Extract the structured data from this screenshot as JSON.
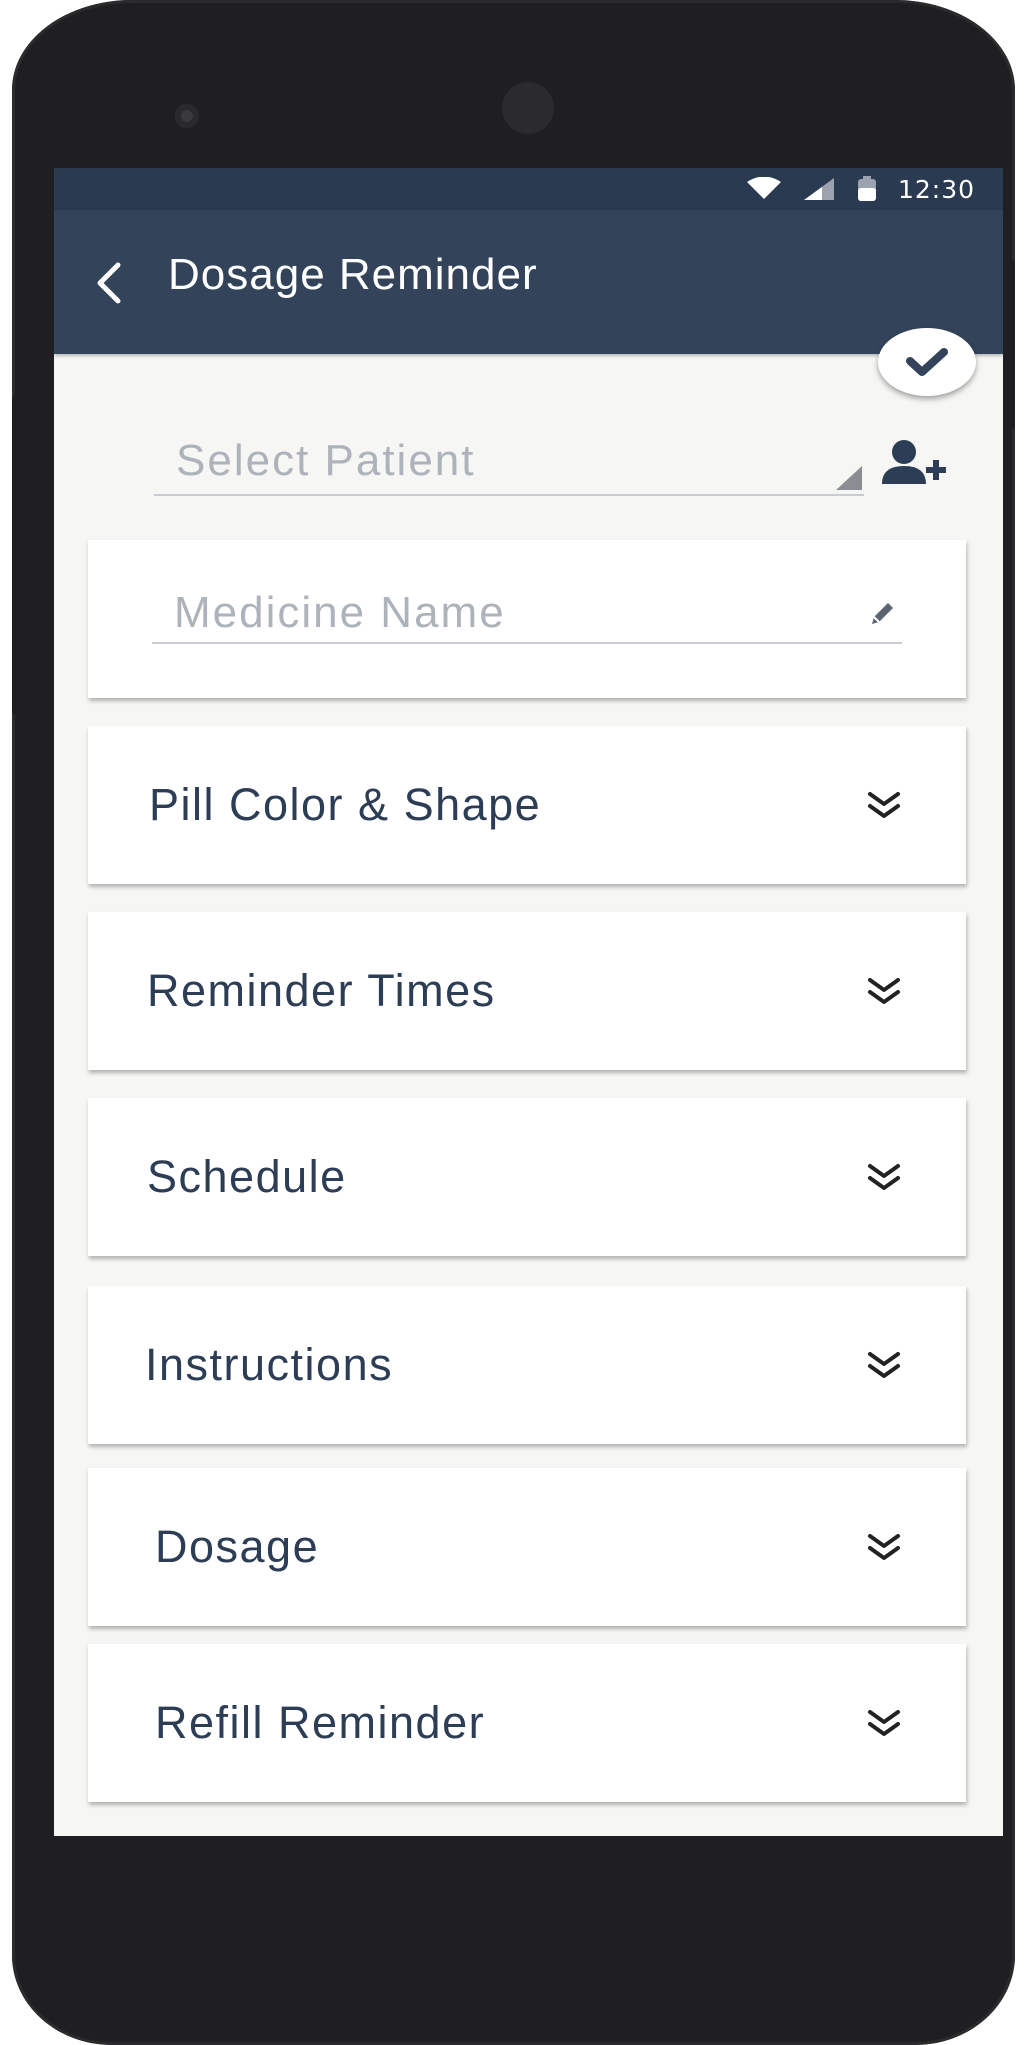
{
  "status_bar": {
    "time": "12:30",
    "icons": [
      "wifi-icon",
      "cell-signal-icon",
      "battery-icon"
    ]
  },
  "app_bar": {
    "title": "Dosage Reminder",
    "back_icon": "chevron-left-icon",
    "color": "#334359"
  },
  "fab": {
    "icon": "check-icon"
  },
  "patient": {
    "placeholder": "Select Patient",
    "add_icon": "add-user-icon"
  },
  "medicine": {
    "placeholder": "Medicine Name",
    "edit_icon": "pencil-icon"
  },
  "sections": [
    {
      "label": "Pill Color & Shape",
      "icon": "double-chevron-down-icon"
    },
    {
      "label": "Reminder Times",
      "icon": "double-chevron-down-icon"
    },
    {
      "label": "Schedule",
      "icon": "double-chevron-down-icon"
    },
    {
      "label": "Instructions",
      "icon": "double-chevron-down-icon"
    },
    {
      "label": "Dosage",
      "icon": "double-chevron-down-icon"
    },
    {
      "label": "Refill Reminder",
      "icon": "double-chevron-down-icon"
    }
  ],
  "colors": {
    "accent": "#334359",
    "text_dark": "#2c3d55",
    "placeholder": "#aeb3bb",
    "background": "#f6f6f4"
  }
}
